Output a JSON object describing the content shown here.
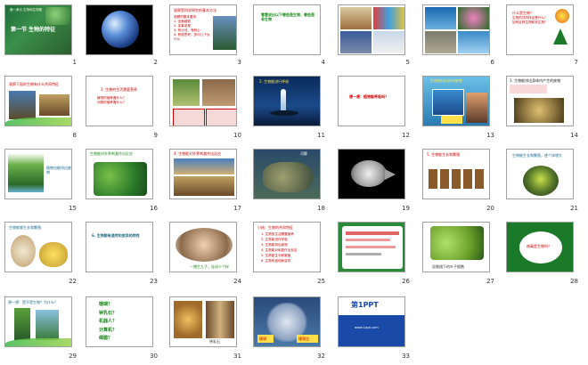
{
  "slides": [
    {
      "n": "1",
      "title": "第一节 生物的特征",
      "subtitle": "第一单元 生物和生物圈"
    },
    {
      "n": "2"
    },
    {
      "n": "3",
      "title": "观察是科学探究的基本方法",
      "lines": "观察的基本要求：\n1. 全面细致\n2. 实事求是\n3. 有计划、有耐心\n4. 积极思考，多问几个为什么"
    },
    {
      "n": "4",
      "title": "看看说出以下哪些是生物，哪些是非生物"
    },
    {
      "n": "5"
    },
    {
      "n": "6"
    },
    {
      "n": "7",
      "title": "什么是生物？",
      "lines": "生物的共同特征是什么？\n如何区别生物和非生物？"
    },
    {
      "n": "8",
      "title": "观察下面的生物有什么共同特征"
    },
    {
      "n": "9",
      "title": "1. 生物的生活需要营养",
      "lines": "植物的营养靠什么？\n动物的营养靠什么？"
    },
    {
      "n": "10"
    },
    {
      "n": "11",
      "title": "2. 生物能进行呼吸"
    },
    {
      "n": "12",
      "title": "想一想：植物能呼吸吗？"
    },
    {
      "n": "13",
      "title": "生物能排出体内废物"
    },
    {
      "n": "14",
      "title": "3. 生物能排出身体内产生的废物"
    },
    {
      "n": "15",
      "title": "植物也能排出废物"
    },
    {
      "n": "16",
      "title": "生物能对外界刺激作出反应"
    },
    {
      "n": "17",
      "title": "4. 生物能对外界刺激作出反应"
    },
    {
      "n": "18",
      "title": "河豚"
    },
    {
      "n": "19"
    },
    {
      "n": "20",
      "title": "5. 生物能生长和繁殖"
    },
    {
      "n": "21",
      "title": "生物能生长和繁殖，使个体增大"
    },
    {
      "n": "22",
      "title": "生物能够生长和繁殖"
    },
    {
      "n": "23",
      "title": "6. 生物都有遗传和变异的特性"
    },
    {
      "n": "24",
      "caption": "一猪生九子，连母十个样"
    },
    {
      "n": "25",
      "title": "小结：生物的共同特征",
      "lines": "1. 生物的生活需要营养\n2. 生物能进行呼吸\n3. 生物能排出废物\n4. 生物能对刺激作出反应\n5. 生物能生长和繁殖\n6. 生物有遗传和变异"
    },
    {
      "n": "26"
    },
    {
      "n": "27",
      "caption": "显微镜下的叶子细胞"
    },
    {
      "n": "28",
      "title": "病毒是生物吗？"
    },
    {
      "n": "29",
      "title": "想一想：是不是生物？为什么？"
    },
    {
      "n": "30",
      "lines": "珊瑚？\n钟乳石？\n机器人？\n计算机？\n细菌？"
    },
    {
      "n": "31",
      "caption": "钟乳石"
    },
    {
      "n": "32",
      "label_a": "珊瑚",
      "label_b": "珊瑚虫"
    },
    {
      "n": "33",
      "logo": "第1PPT",
      "lines": "www.1ppt.com"
    }
  ],
  "colors": {
    "title_red": "#cc0000",
    "green_wave": "#3cb84a",
    "green_text": "#1a8a1a"
  }
}
